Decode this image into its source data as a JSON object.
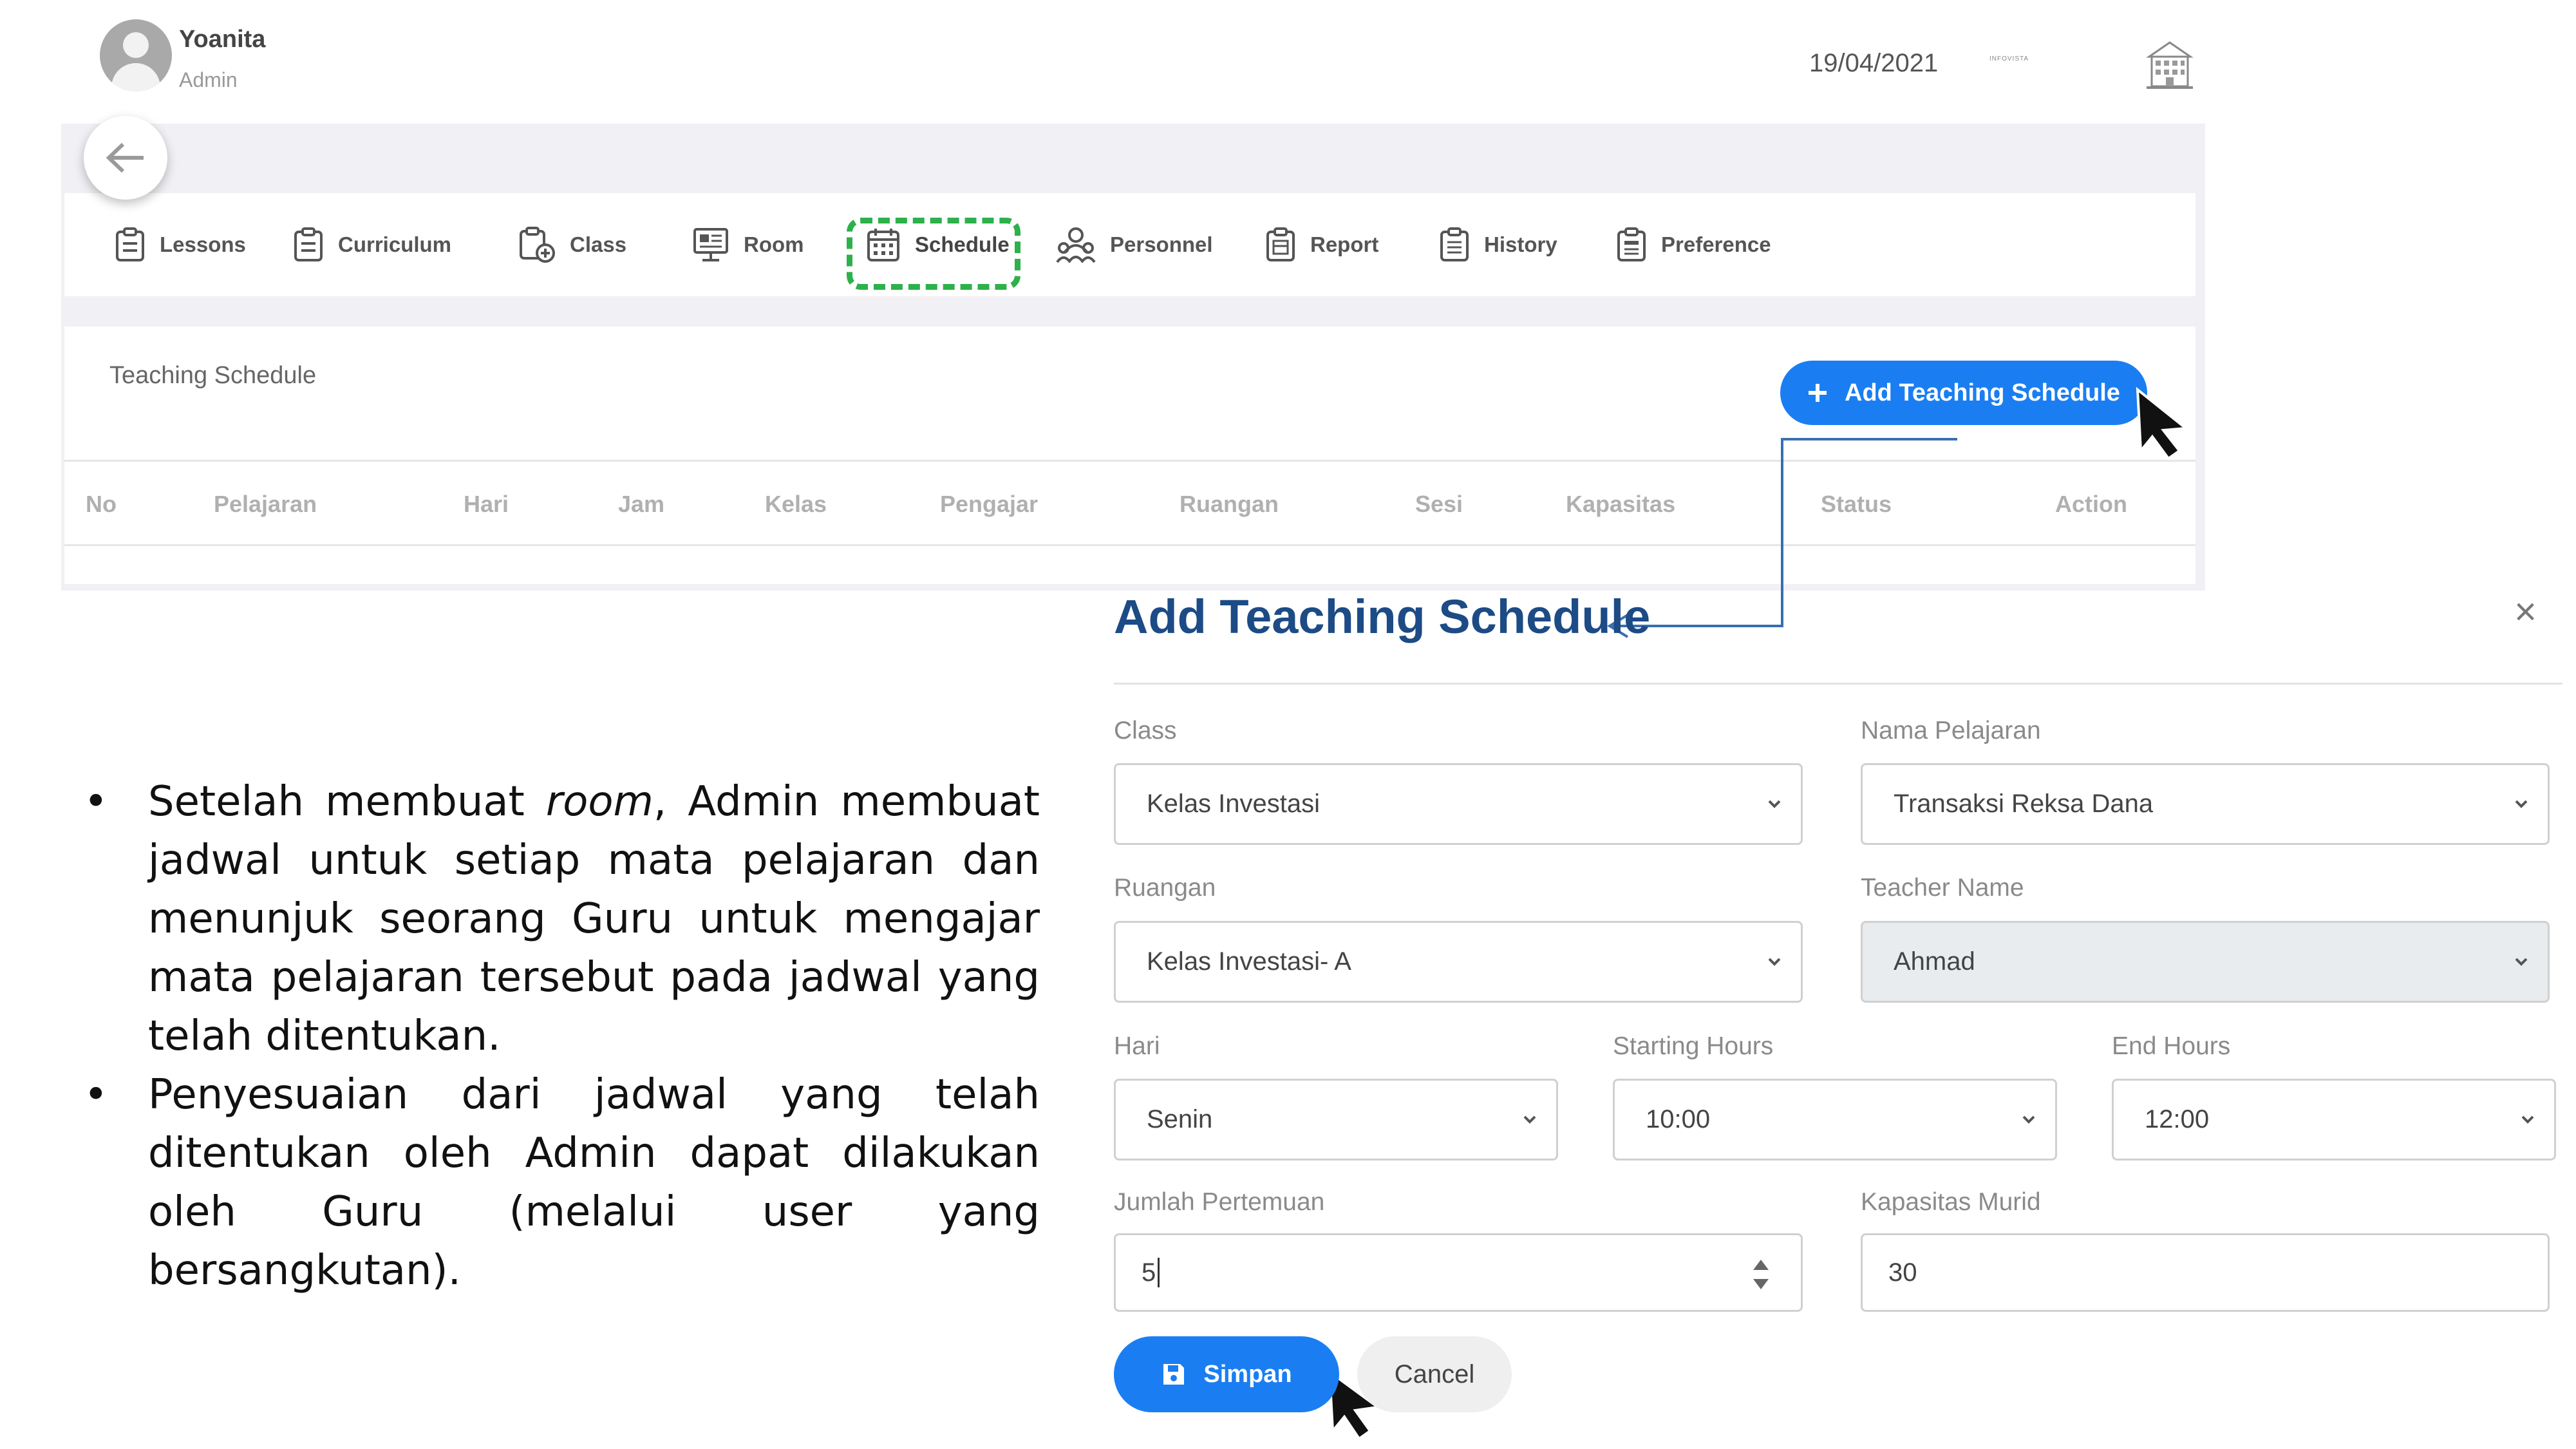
{
  "header": {
    "user_name": "Yoanita",
    "user_role": "Admin",
    "date": "19/04/2021",
    "logo_text": "INFOVISTA",
    "avatar_icon": "user-avatar-icon",
    "building_icon": "building-icon"
  },
  "nav": {
    "items": [
      {
        "label": "Lessons",
        "icon": "clipboard-icon"
      },
      {
        "label": "Curriculum",
        "icon": "clipboard-icon"
      },
      {
        "label": "Class",
        "icon": "clipboard-add-icon"
      },
      {
        "label": "Room",
        "icon": "monitor-icon"
      },
      {
        "label": "Schedule",
        "icon": "calendar-icon",
        "active": true
      },
      {
        "label": "Personnel",
        "icon": "people-icon"
      },
      {
        "label": "Report",
        "icon": "clipboard-report-icon"
      },
      {
        "label": "History",
        "icon": "clipboard-history-icon"
      },
      {
        "label": "Preference",
        "icon": "clipboard-settings-icon"
      }
    ],
    "active_highlight_color": "#2db14a"
  },
  "schedule": {
    "title": "Teaching Schedule",
    "add_button": "Add Teaching Schedule",
    "columns": [
      "No",
      "Pelajaran",
      "Hari",
      "Jam",
      "Kelas",
      "Pengajar",
      "Ruangan",
      "Sesi",
      "Kapasitas",
      "Status",
      "Action"
    ]
  },
  "modal": {
    "title": "Add Teaching Schedule",
    "close": "×",
    "class_label": "Class",
    "class_value": "Kelas Investasi",
    "nama_pelajaran_label": "Nama Pelajaran",
    "nama_pelajaran_value": "Transaksi Reksa Dana",
    "ruangan_label": "Ruangan",
    "ruangan_value": "Kelas Investasi- A",
    "teacher_label": "Teacher Name",
    "teacher_value": "Ahmad",
    "hari_label": "Hari",
    "hari_value": "Senin",
    "start_label": "Starting Hours",
    "start_value": "10:00",
    "end_label": "End Hours",
    "end_value": "12:00",
    "jumlah_label": "Jumlah Pertemuan",
    "jumlah_value": "5",
    "kapasitas_label": "Kapasitas Murid",
    "kapasitas_value": "30",
    "save_button": "Simpan",
    "cancel_button": "Cancel"
  },
  "notes": {
    "bullet1_a": "Setelah membuat ",
    "bullet1_em": "room",
    "bullet1_b": ", Admin membuat jadwal untuk setiap mata pelajaran dan menunjuk seorang Guru untuk mengajar mata pelajaran tersebut pada jadwal yang telah ditentukan.",
    "bullet2": "Penyesuaian dari jadwal yang telah ditentukan oleh Admin dapat dilakukan oleh Guru (melalui user yang bersangkutan)."
  },
  "colors": {
    "primary": "#1a7ef2",
    "title_blue": "#1c4b86",
    "panel_bg": "#f0f0f5"
  }
}
